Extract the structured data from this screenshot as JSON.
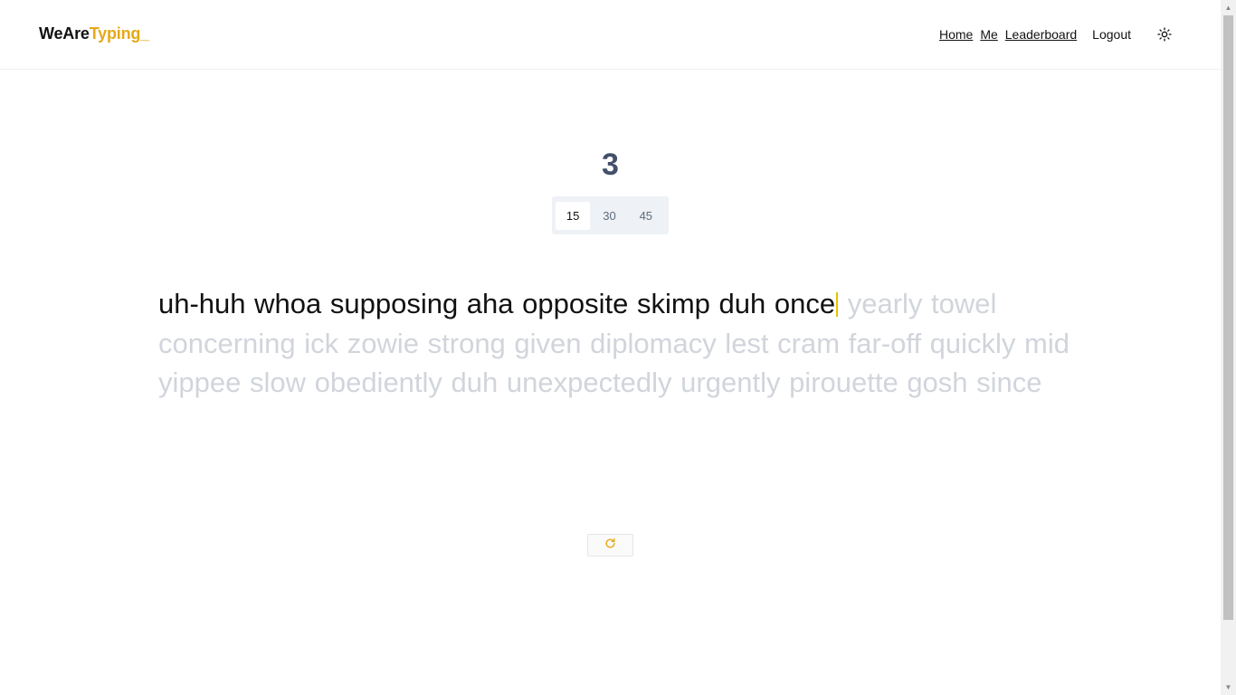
{
  "header": {
    "logo_part1": "WeAre",
    "logo_part2": "Typing_",
    "nav": {
      "home": "Home",
      "me": "Me",
      "leaderboard": "Leaderboard",
      "logout": "Logout"
    },
    "theme_icon": "sun-icon"
  },
  "timer": {
    "countdown": "3",
    "durations": [
      "15",
      "30",
      "45"
    ],
    "selected_duration": "15"
  },
  "typing": {
    "typed_text": "uh-huh whoa supposing aha opposite skimp duh once",
    "remaining_text": " yearly towel concerning ick zowie strong given diplomacy lest cram far-off quickly mid yippee slow obediently duh unexpectedly urgently pirouette gosh since"
  },
  "restart": {
    "icon": "refresh-icon"
  },
  "colors": {
    "accent": "#e6a817",
    "typed": "#111111",
    "untyped": "#d1d5db",
    "countdown": "#44506a",
    "caret": "#e6c300"
  }
}
